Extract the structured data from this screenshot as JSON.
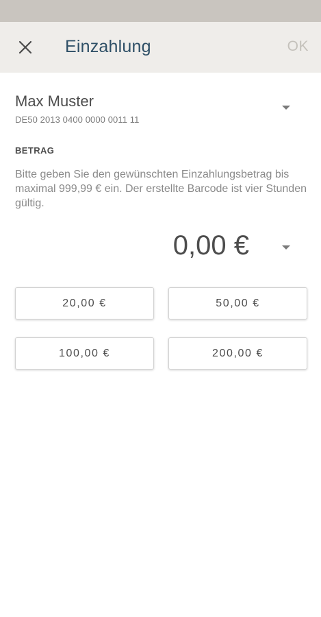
{
  "header": {
    "title": "Einzahlung",
    "ok_label": "OK",
    "close_icon": "close-icon"
  },
  "account": {
    "name": "Max Muster",
    "iban": "DE50 2013 0400 0000 0011 11"
  },
  "amount_section": {
    "label": "BETRAG",
    "info": "Bitte geben Sie den gewünschten Einzahlungsbetrag bis maximal 999,99 € ein. Der erstellte Barcode ist vier Stunden gültig.",
    "current_value": "0,00 €"
  },
  "quick_amounts": [
    "20,00 €",
    "50,00 €",
    "100,00 €",
    "200,00 €"
  ],
  "colors": {
    "status_bar": "#c9c5bf",
    "app_bar": "#efedea",
    "title": "#2e4f66",
    "ok_disabled": "#c4c1bb"
  }
}
